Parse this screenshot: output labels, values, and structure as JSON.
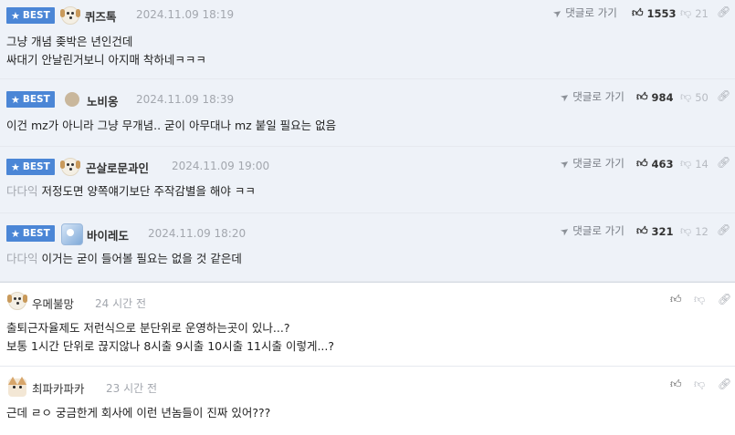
{
  "best_label": "BEST",
  "reply_label": "댓글로 가기",
  "comments": [
    {
      "kind": "best",
      "nick": "퀴즈톡",
      "time": "2024.11.09 18:19",
      "up": "1553",
      "down": "21",
      "mention": "",
      "lines": [
        "그냥 개념 좆박은 년인건데",
        "싸대기 안날린거보니 아지매 착하네ㅋㅋㅋ"
      ]
    },
    {
      "kind": "best",
      "nick": "노비옹",
      "time": "2024.11.09 18:39",
      "up": "984",
      "down": "50",
      "mention": "",
      "lines": [
        "이건 mz가 아니라 그냥 무개념.. 굳이 아무대나 mz 붙일 필요는 없음"
      ]
    },
    {
      "kind": "best",
      "nick": "곤살로문과인",
      "time": "2024.11.09 19:00",
      "up": "463",
      "down": "14",
      "mention": "다다익",
      "lines": [
        "저정도면 양쪽얘기보단 주작감별을 해야 ㅋㅋ"
      ]
    },
    {
      "kind": "best",
      "nick": "바이레도",
      "time": "2024.11.09 18:20",
      "up": "321",
      "down": "12",
      "mention": "다다익",
      "lines": [
        "이거는 굳이 들어볼 필요는 없을 것 같은데"
      ]
    },
    {
      "kind": "normal",
      "nick": "우메불망",
      "time": "24 시간 전",
      "mention": "",
      "lines": [
        "출퇴근자율제도 저런식으로 분단위로 운영하는곳이 있나...?",
        "보통 1시간 단위로 끊지않나 8시출 9시출 10시출 11시출 이렇게...?"
      ]
    },
    {
      "kind": "normal",
      "nick": "최파카파카",
      "time": "23 시간 전",
      "mention": "",
      "lines": [
        "근데 ㄹㅇ 궁금한게 회사에 이런 년놈들이 진짜 있어???"
      ]
    }
  ],
  "icons": [
    "star-icon",
    "plane-icon",
    "thumbs-up-icon",
    "thumbs-down-icon",
    "link-icon"
  ]
}
